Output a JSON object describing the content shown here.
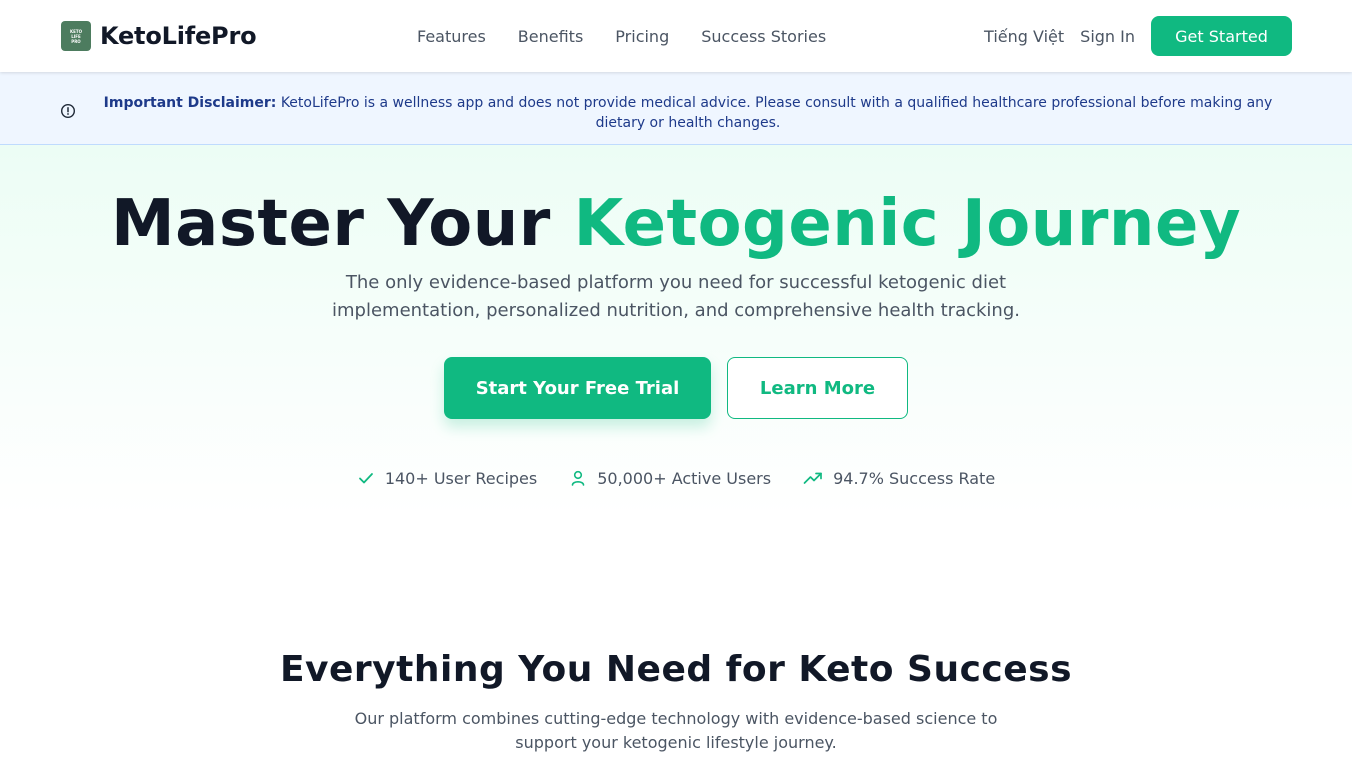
{
  "header": {
    "brand": "KetoLifePro",
    "logo_text": [
      "KETO",
      "LIFE",
      "PRO"
    ],
    "nav": [
      "Features",
      "Benefits",
      "Pricing",
      "Success Stories"
    ],
    "language": "Tiếng Việt",
    "sign_in": "Sign In",
    "get_started": "Get Started"
  },
  "disclaimer": {
    "label": "Important Disclaimer:",
    "text": "KetoLifePro is a wellness app and does not provide medical advice. Please consult with a qualified healthcare professional before making any dietary or health changes."
  },
  "hero": {
    "title_part1": "Master Your ",
    "title_accent": "Ketogenic Journey",
    "subtitle": "The only evidence-based platform you need for successful ketogenic diet implementation, personalized nutrition, and comprehensive health tracking.",
    "cta_primary": "Start Your Free Trial",
    "cta_secondary": "Learn More",
    "stats": [
      {
        "icon": "check-icon",
        "label": "140+ User Recipes"
      },
      {
        "icon": "user-icon",
        "label": "50,000+ Active Users"
      },
      {
        "icon": "trending-up-icon",
        "label": "94.7% Success Rate"
      }
    ]
  },
  "features": {
    "title": "Everything You Need for Keto Success",
    "subtitle": "Our platform combines cutting-edge technology with evidence-based science to support your ketogenic lifestyle journey."
  },
  "colors": {
    "accent": "#10b981",
    "text_dark": "#111827",
    "text_muted": "#4b5563",
    "disclaimer_bg": "#eff6ff",
    "disclaimer_text": "#1e3a8a"
  }
}
